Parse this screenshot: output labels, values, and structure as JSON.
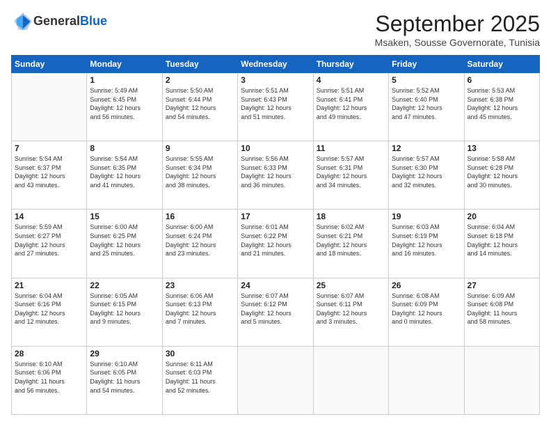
{
  "header": {
    "logo_general": "General",
    "logo_blue": "Blue",
    "month_year": "September 2025",
    "location": "Msaken, Sousse Governorate, Tunisia"
  },
  "days_of_week": [
    "Sunday",
    "Monday",
    "Tuesday",
    "Wednesday",
    "Thursday",
    "Friday",
    "Saturday"
  ],
  "weeks": [
    [
      {
        "day": "",
        "info": ""
      },
      {
        "day": "1",
        "info": "Sunrise: 5:49 AM\nSunset: 6:45 PM\nDaylight: 12 hours\nand 56 minutes."
      },
      {
        "day": "2",
        "info": "Sunrise: 5:50 AM\nSunset: 6:44 PM\nDaylight: 12 hours\nand 54 minutes."
      },
      {
        "day": "3",
        "info": "Sunrise: 5:51 AM\nSunset: 6:43 PM\nDaylight: 12 hours\nand 51 minutes."
      },
      {
        "day": "4",
        "info": "Sunrise: 5:51 AM\nSunset: 6:41 PM\nDaylight: 12 hours\nand 49 minutes."
      },
      {
        "day": "5",
        "info": "Sunrise: 5:52 AM\nSunset: 6:40 PM\nDaylight: 12 hours\nand 47 minutes."
      },
      {
        "day": "6",
        "info": "Sunrise: 5:53 AM\nSunset: 6:38 PM\nDaylight: 12 hours\nand 45 minutes."
      }
    ],
    [
      {
        "day": "7",
        "info": "Sunrise: 5:54 AM\nSunset: 6:37 PM\nDaylight: 12 hours\nand 43 minutes."
      },
      {
        "day": "8",
        "info": "Sunrise: 5:54 AM\nSunset: 6:35 PM\nDaylight: 12 hours\nand 41 minutes."
      },
      {
        "day": "9",
        "info": "Sunrise: 5:55 AM\nSunset: 6:34 PM\nDaylight: 12 hours\nand 38 minutes."
      },
      {
        "day": "10",
        "info": "Sunrise: 5:56 AM\nSunset: 6:33 PM\nDaylight: 12 hours\nand 36 minutes."
      },
      {
        "day": "11",
        "info": "Sunrise: 5:57 AM\nSunset: 6:31 PM\nDaylight: 12 hours\nand 34 minutes."
      },
      {
        "day": "12",
        "info": "Sunrise: 5:57 AM\nSunset: 6:30 PM\nDaylight: 12 hours\nand 32 minutes."
      },
      {
        "day": "13",
        "info": "Sunrise: 5:58 AM\nSunset: 6:28 PM\nDaylight: 12 hours\nand 30 minutes."
      }
    ],
    [
      {
        "day": "14",
        "info": "Sunrise: 5:59 AM\nSunset: 6:27 PM\nDaylight: 12 hours\nand 27 minutes."
      },
      {
        "day": "15",
        "info": "Sunrise: 6:00 AM\nSunset: 6:25 PM\nDaylight: 12 hours\nand 25 minutes."
      },
      {
        "day": "16",
        "info": "Sunrise: 6:00 AM\nSunset: 6:24 PM\nDaylight: 12 hours\nand 23 minutes."
      },
      {
        "day": "17",
        "info": "Sunrise: 6:01 AM\nSunset: 6:22 PM\nDaylight: 12 hours\nand 21 minutes."
      },
      {
        "day": "18",
        "info": "Sunrise: 6:02 AM\nSunset: 6:21 PM\nDaylight: 12 hours\nand 18 minutes."
      },
      {
        "day": "19",
        "info": "Sunrise: 6:03 AM\nSunset: 6:19 PM\nDaylight: 12 hours\nand 16 minutes."
      },
      {
        "day": "20",
        "info": "Sunrise: 6:04 AM\nSunset: 6:18 PM\nDaylight: 12 hours\nand 14 minutes."
      }
    ],
    [
      {
        "day": "21",
        "info": "Sunrise: 6:04 AM\nSunset: 6:16 PM\nDaylight: 12 hours\nand 12 minutes."
      },
      {
        "day": "22",
        "info": "Sunrise: 6:05 AM\nSunset: 6:15 PM\nDaylight: 12 hours\nand 9 minutes."
      },
      {
        "day": "23",
        "info": "Sunrise: 6:06 AM\nSunset: 6:13 PM\nDaylight: 12 hours\nand 7 minutes."
      },
      {
        "day": "24",
        "info": "Sunrise: 6:07 AM\nSunset: 6:12 PM\nDaylight: 12 hours\nand 5 minutes."
      },
      {
        "day": "25",
        "info": "Sunrise: 6:07 AM\nSunset: 6:11 PM\nDaylight: 12 hours\nand 3 minutes."
      },
      {
        "day": "26",
        "info": "Sunrise: 6:08 AM\nSunset: 6:09 PM\nDaylight: 12 hours\nand 0 minutes."
      },
      {
        "day": "27",
        "info": "Sunrise: 6:09 AM\nSunset: 6:08 PM\nDaylight: 11 hours\nand 58 minutes."
      }
    ],
    [
      {
        "day": "28",
        "info": "Sunrise: 6:10 AM\nSunset: 6:06 PM\nDaylight: 11 hours\nand 56 minutes."
      },
      {
        "day": "29",
        "info": "Sunrise: 6:10 AM\nSunset: 6:05 PM\nDaylight: 11 hours\nand 54 minutes."
      },
      {
        "day": "30",
        "info": "Sunrise: 6:11 AM\nSunset: 6:03 PM\nDaylight: 11 hours\nand 52 minutes."
      },
      {
        "day": "",
        "info": ""
      },
      {
        "day": "",
        "info": ""
      },
      {
        "day": "",
        "info": ""
      },
      {
        "day": "",
        "info": ""
      }
    ]
  ]
}
